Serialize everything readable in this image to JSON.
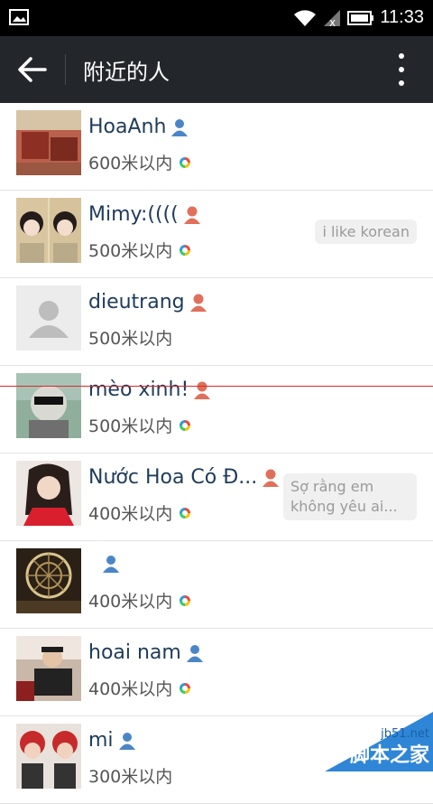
{
  "status_bar": {
    "time": "11:33"
  },
  "header": {
    "title": "附近的人"
  },
  "people": [
    {
      "name": "HoaAnh",
      "distance": "600米以内",
      "gender": "male",
      "ring": true,
      "bubble": ""
    },
    {
      "name": "Mimy:((((",
      "distance": "500米以内",
      "gender": "female",
      "ring": true,
      "bubble": "i like korean"
    },
    {
      "name": "dieutrang",
      "distance": "500米以内",
      "gender": "female",
      "ring": false,
      "bubble": ""
    },
    {
      "name": "mèo xinh!",
      "distance": "500米以内",
      "gender": "female",
      "ring": true,
      "bubble": ""
    },
    {
      "name": "Nước Hoa Có Đ...",
      "distance": "400米以内",
      "gender": "female",
      "ring": true,
      "bubble": "Sợ rằng em không yêu ai..."
    },
    {
      "name": "",
      "distance": "400米以内",
      "gender": "male",
      "ring": true,
      "bubble": ""
    },
    {
      "name": "hoai nam",
      "distance": "400米以内",
      "gender": "male",
      "ring": true,
      "bubble": ""
    },
    {
      "name": "mi",
      "distance": "300米以内",
      "gender": "male",
      "ring": false,
      "bubble": ""
    }
  ],
  "watermark": {
    "top": "jb51.net",
    "main": "脚本之家"
  },
  "colors": {
    "male": "#4a86c7",
    "female": "#e0705a",
    "bar": "#23272c"
  }
}
